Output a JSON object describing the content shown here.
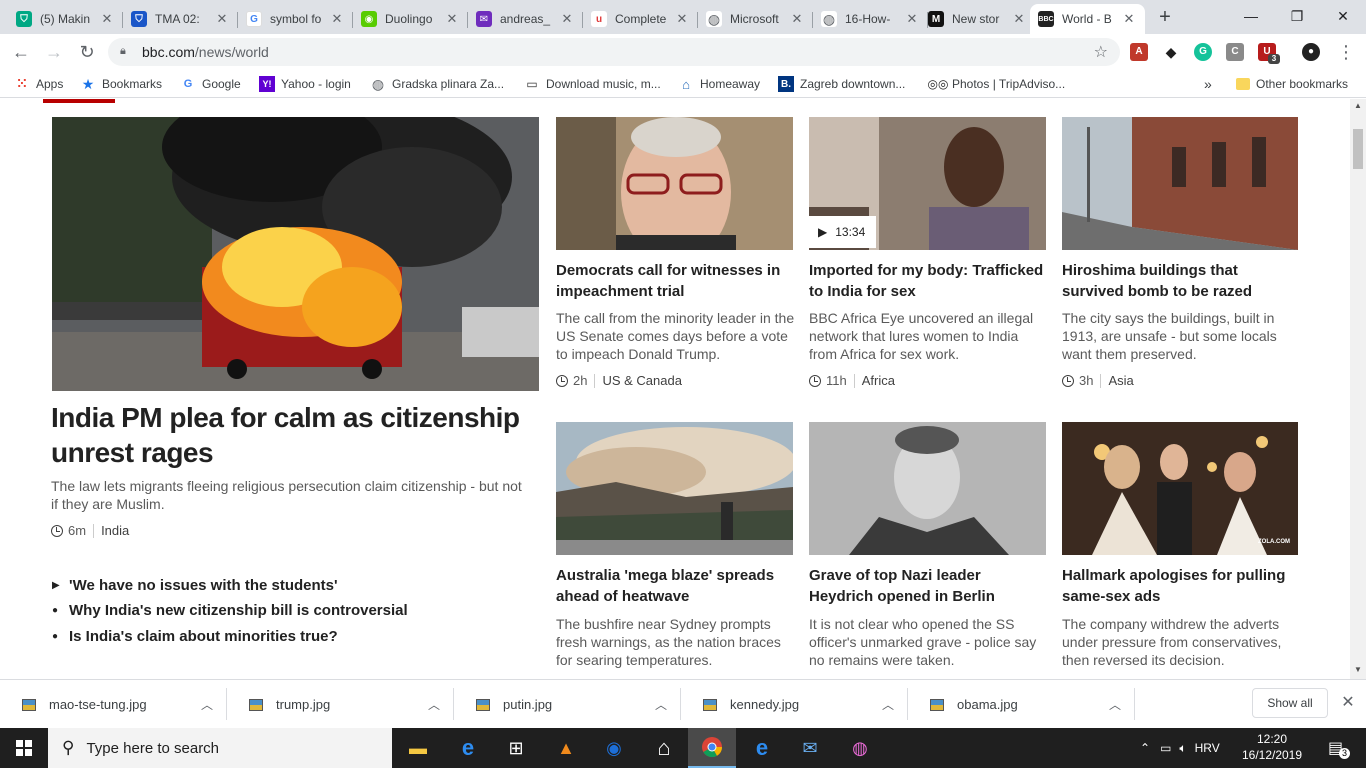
{
  "tabs": [
    {
      "title": "(5) Makin",
      "icon_color": "#00a884",
      "icon": "shield"
    },
    {
      "title": "TMA 02:",
      "icon_color": "#1a56c8",
      "icon": "shield"
    },
    {
      "title": "symbol fo",
      "icon_color": "#4285f4",
      "icon": "google"
    },
    {
      "title": "Duolingo",
      "icon_color": "#58cc02",
      "icon": "owl"
    },
    {
      "title": "andreas_",
      "icon_color": "#6f2dbd",
      "icon": "mail"
    },
    {
      "title": "Complete",
      "icon_color": "#e03a3a",
      "icon": "u"
    },
    {
      "title": "Microsoft",
      "icon_color": "#5f6368",
      "icon": "globe"
    },
    {
      "title": "16-How-",
      "icon_color": "#5f6368",
      "icon": "globe"
    },
    {
      "title": "New stor",
      "icon_color": "#111111",
      "icon": "M"
    },
    {
      "title": "World - B",
      "icon_color": "#222222",
      "icon": "bbc"
    }
  ],
  "window_controls": {
    "minimize": "—",
    "restore": "❐",
    "close": "✕"
  },
  "toolbar": {
    "url_host": "bbc.com",
    "url_path": "/news/world"
  },
  "extensions": [
    {
      "label": "A",
      "color": "#c0392b"
    },
    {
      "label": "◆",
      "color": "#1f1f1f"
    },
    {
      "label": "G",
      "color": "#15c39a"
    },
    {
      "label": "C",
      "color": "#8a8a8a"
    },
    {
      "label": "U",
      "color": "#b71c1c"
    },
    {
      "label": "●",
      "color": "#222222"
    }
  ],
  "extension_badge": "3",
  "bookmarks": [
    {
      "label": "Apps",
      "icon": "apps-grid",
      "color": "#ea4335"
    },
    {
      "label": "Bookmarks",
      "icon": "star",
      "color": "#1a73e8"
    },
    {
      "label": "Google",
      "icon": "G",
      "color": "#4285f4"
    },
    {
      "label": "Yahoo - login",
      "icon": "Y!",
      "color": "#6001d2"
    },
    {
      "label": "Gradska plinara Za...",
      "icon": "globe",
      "color": "#5f6368"
    },
    {
      "label": "Download music, m...",
      "icon": "pc",
      "color": "#333333"
    },
    {
      "label": "Homeaway",
      "icon": "house",
      "color": "#2a6ebb"
    },
    {
      "label": "Zagreb downtown...",
      "icon": "B.",
      "color": "#003580"
    },
    {
      "label": "Photos | TripAdviso...",
      "icon": "owl",
      "color": "#222222"
    }
  ],
  "bookmarks_overflow": "»",
  "other_bookmarks": "Other bookmarks",
  "main_story": {
    "headline": "India PM plea for calm as citizenship unrest rages",
    "summary": "The law lets migrants fleeing religious persecution claim citizenship - but not if they are Muslim.",
    "time": "6m",
    "section": "India",
    "related": [
      {
        "bullet": "▶",
        "text": "'We have no issues with the students'"
      },
      {
        "bullet": "●",
        "text": "Why India's new citizenship bill is controversial"
      },
      {
        "bullet": "●",
        "text": "Is India's claim about minorities true?"
      }
    ]
  },
  "stories": [
    {
      "headline": "Democrats call for witnesses in impeachment trial",
      "summary": "The call from the minority leader in the US Senate comes days before a vote to impeach Donald Trump.",
      "time": "2h",
      "section": "US & Canada"
    },
    {
      "headline": "Imported for my body: Trafficked to India for sex",
      "summary": "BBC Africa Eye uncovered an illegal network that lures women to India from Africa for sex work.",
      "time": "11h",
      "section": "Africa",
      "video_duration": "13:34"
    },
    {
      "headline": "Hiroshima buildings that survived bomb to be razed",
      "summary": "The city says the buildings, built in 1913, are unsafe - but some locals want them preserved.",
      "time": "3h",
      "section": "Asia"
    },
    {
      "headline": "Australia 'mega blaze' spreads ahead of heatwave",
      "summary": "The bushfire near Sydney prompts fresh warnings, as the nation braces for searing temperatures."
    },
    {
      "headline": "Grave of top Nazi leader Heydrich opened in Berlin",
      "summary": "It is not clear who opened the SS officer's unmarked grave - police say no remains were taken."
    },
    {
      "headline": "Hallmark apologises for pulling same-sex ads",
      "summary": "The company withdrew the adverts under pressure from conservatives, then reversed its decision.",
      "image_watermark": "ZOLA.COM"
    }
  ],
  "downloads": [
    {
      "name": "mao-tse-tung.jpg"
    },
    {
      "name": "trump.jpg"
    },
    {
      "name": "putin.jpg"
    },
    {
      "name": "kennedy.jpg"
    },
    {
      "name": "obama.jpg"
    }
  ],
  "downloads_show_all": "Show all",
  "taskbar": {
    "search_placeholder": "Type here to search",
    "language": "HRV",
    "time": "12:20",
    "date": "16/12/2019",
    "notification_count": "3"
  }
}
